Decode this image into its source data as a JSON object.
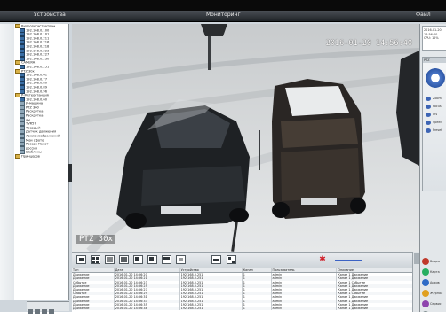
{
  "app": {
    "menu": [
      "Устройства",
      "Мониторинг",
      "Файл"
    ],
    "window_buttons": [
      "–",
      "□",
      "×"
    ]
  },
  "tree": {
    "items": [
      {
        "label": "Видеорегистраторы",
        "kind": "grp"
      },
      {
        "label": "192.168.0.100",
        "kind": "cam"
      },
      {
        "label": "192.168.0.101",
        "kind": "cam"
      },
      {
        "label": "192.168.0.211",
        "kind": "cam"
      },
      {
        "label": "192.168.0.216",
        "kind": "cam"
      },
      {
        "label": "192.168.0.218",
        "kind": "cam"
      },
      {
        "label": "192.168.0.223",
        "kind": "cam"
      },
      {
        "label": "192.168.0.227",
        "kind": "cam"
      },
      {
        "label": "192.168.0.230",
        "kind": "cam"
      },
      {
        "label": "CAMERA",
        "kind": "grp"
      },
      {
        "label": "192.168.0.251",
        "kind": "cam"
      },
      {
        "label": "PTZ 30x",
        "kind": "grp"
      },
      {
        "label": "192.168.0.61",
        "kind": "cam"
      },
      {
        "label": "192.168.0.77",
        "kind": "cam"
      },
      {
        "label": "192.168.0.80",
        "kind": "cam"
      },
      {
        "label": "192.168.0.89",
        "kind": "cam"
      },
      {
        "label": "192.168.0.96",
        "kind": "cam"
      },
      {
        "label": "Р-Метеостанция",
        "kind": "grp"
      },
      {
        "label": "192.168.0.60",
        "kind": "cam"
      },
      {
        "label": "И-машина",
        "kind": "sys"
      },
      {
        "label": "PTZ 360",
        "kind": "sys"
      },
      {
        "label": "Раскрутка",
        "kind": "sys"
      },
      {
        "label": "Раскрутка",
        "kind": "sys"
      },
      {
        "label": "ям",
        "kind": "sys"
      },
      {
        "label": "TVR57",
        "kind": "sys"
      },
      {
        "label": "Твердый",
        "kind": "sys"
      },
      {
        "label": "Датчик движения",
        "kind": "sys"
      },
      {
        "label": "Архив изображений",
        "kind": "sys"
      },
      {
        "label": "Мои сфото",
        "kind": "sys"
      },
      {
        "label": "Резерв Пакет",
        "kind": "sys"
      },
      {
        "label": "россия",
        "kind": "sys"
      },
      {
        "label": "Шаблоны",
        "kind": "sys"
      },
      {
        "label": "Принцоров",
        "kind": "grp"
      }
    ]
  },
  "video": {
    "timestamp": "2016-01-20 14:56:40",
    "camera_label": "PTZ 30x"
  },
  "log": {
    "columns": [
      "Тип",
      "Дата",
      "Устройство",
      "Канал",
      "Пользователь",
      "Описание"
    ],
    "rows": [
      [
        "Движение",
        "2016-01-20 14:56:20",
        "192.168.0.251",
        "1",
        "admin",
        "Канал 1 Движение"
      ],
      [
        "Движение",
        "2016-01-20 14:56:21",
        "192.168.0.251",
        "1",
        "admin",
        "Канал 1 Движение"
      ],
      [
        "Событие",
        "2016-01-20 14:56:23",
        "192.168.0.251",
        "1",
        "admin",
        "Канал 1 Событие"
      ],
      [
        "Движение",
        "2016-01-20 14:56:25",
        "192.168.0.251",
        "1",
        "admin",
        "Канал 1 Движение"
      ],
      [
        "Движение",
        "2016-01-20 14:56:27",
        "192.168.0.251",
        "1",
        "admin",
        "Канал 1 Движение"
      ],
      [
        "Событие",
        "2016-01-20 14:56:29",
        "192.168.0.251",
        "1",
        "admin",
        "Канал 1 Событие"
      ],
      [
        "Движение",
        "2016-01-20 14:56:31",
        "192.168.0.251",
        "1",
        "admin",
        "Канал 1 Движение"
      ],
      [
        "Движение",
        "2016-01-20 14:56:33",
        "192.168.0.251",
        "1",
        "admin",
        "Канал 1 Движение"
      ],
      [
        "Движение",
        "2016-01-20 14:56:35",
        "192.168.0.251",
        "1",
        "admin",
        "Канал 1 Движение"
      ],
      [
        "Движение",
        "2016-01-20 14:56:38",
        "192.168.0.251",
        "1",
        "admin",
        "Канал 1 Движение"
      ]
    ]
  },
  "right": {
    "clock_lines": [
      "2016-01-20",
      "14:56:40",
      "CPU: 12%"
    ],
    "ptz_header": "PTZ",
    "ptz_labels": [
      "Zoom",
      "Focus",
      "Iris",
      "Speed",
      "Preset"
    ],
    "plugins": [
      {
        "label": "Видео",
        "color": "#c0392b"
      },
      {
        "label": "Карта",
        "color": "#27ae60"
      },
      {
        "label": "Архив",
        "color": "#2e6bc6"
      },
      {
        "label": "Журнал",
        "color": "#e0a020"
      },
      {
        "label": "Сервис",
        "color": "#8e44ad"
      },
      {
        "label": "Выход",
        "color": "#7f8c8d"
      }
    ]
  },
  "toolbar": {
    "buttons": [
      "1x1",
      "2x2",
      "3x3",
      "4x4",
      "1+5",
      "1+7",
      "full",
      "snapshot",
      "record",
      "pip"
    ]
  }
}
